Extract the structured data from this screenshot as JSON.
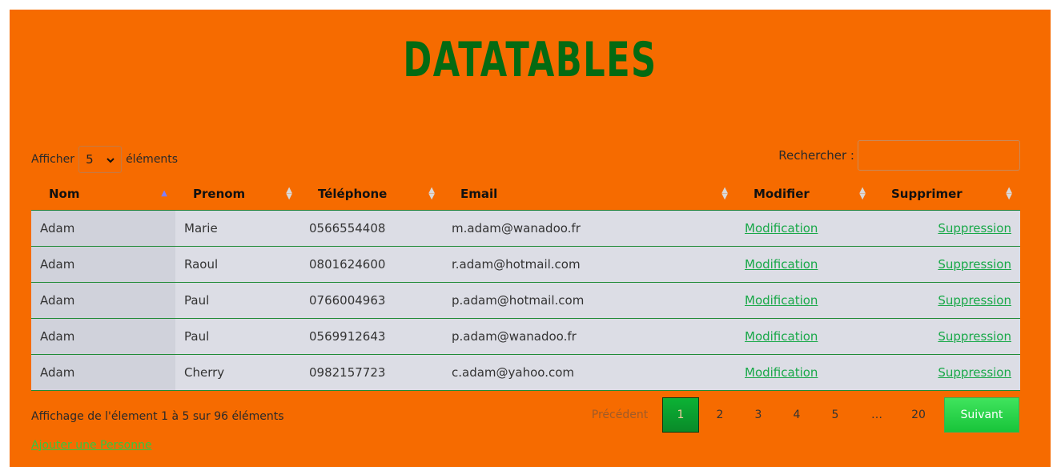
{
  "title": "DATATABLES",
  "length": {
    "prefix": "Afficher",
    "value": "5",
    "suffix": "éléments"
  },
  "search": {
    "label": "Rechercher :",
    "placeholder": ""
  },
  "columns": [
    "Nom",
    "Prenom",
    "Téléphone",
    "Email",
    "Modifier",
    "Supprimer"
  ],
  "rows": [
    {
      "nom": "Adam",
      "prenom": "Marie",
      "tel": "0566554408",
      "email": "m.adam@wanadoo.fr",
      "edit": "Modification",
      "del": "Suppression"
    },
    {
      "nom": "Adam",
      "prenom": "Raoul",
      "tel": "0801624600",
      "email": "r.adam@hotmail.com",
      "edit": "Modification",
      "del": "Suppression"
    },
    {
      "nom": "Adam",
      "prenom": "Paul",
      "tel": "0766004963",
      "email": "p.adam@hotmail.com",
      "edit": "Modification",
      "del": "Suppression"
    },
    {
      "nom": "Adam",
      "prenom": "Paul",
      "tel": "0569912643",
      "email": "p.adam@wanadoo.fr",
      "edit": "Modification",
      "del": "Suppression"
    },
    {
      "nom": "Adam",
      "prenom": "Cherry",
      "tel": "0982157723",
      "email": "c.adam@yahoo.com",
      "edit": "Modification",
      "del": "Suppression"
    }
  ],
  "info": "Affichage de l'élement 1 à 5 sur 96 éléments",
  "pagination": {
    "previous": "Précédent",
    "pages": [
      "1",
      "2",
      "3",
      "4",
      "5",
      "…",
      "20"
    ],
    "current": "1",
    "next": "Suivant"
  },
  "add_link": "Ajouter une Personne",
  "colors": {
    "background": "#f66b00",
    "title": "#046a12",
    "link": "#18a848",
    "active_page": "#0a9a2e"
  }
}
